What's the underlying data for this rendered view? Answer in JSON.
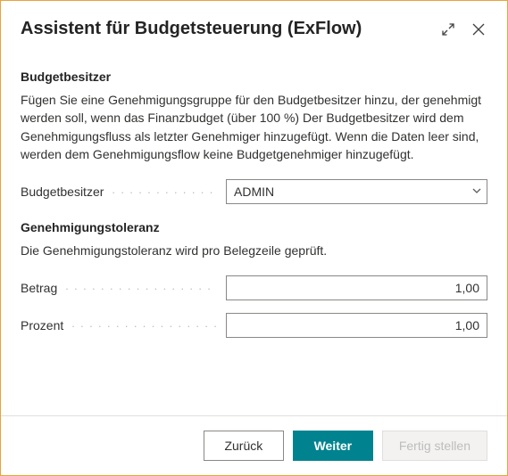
{
  "header": {
    "title": "Assistent für Budgetsteuerung (ExFlow)"
  },
  "section_owner": {
    "title": "Budgetbesitzer",
    "desc": "Fügen Sie eine Genehmigungsgruppe für den Budgetbesitzer hinzu, der genehmigt werden soll, wenn das Finanzbudget (über 100 %) Der Budgetbesitzer wird dem Genehmigungsfluss als letzter Genehmiger hinzugefügt. Wenn die Daten leer sind, werden dem Genehmigungsflow keine Budgetgenehmiger hinzugefügt.",
    "field_label": "Budgetbesitzer",
    "field_value": "ADMIN"
  },
  "section_tolerance": {
    "title": "Genehmigungstoleranz",
    "desc": "Die Genehmigungstoleranz wird pro Belegzeile geprüft.",
    "amount_label": "Betrag",
    "amount_value": "1,00",
    "percent_label": "Prozent",
    "percent_value": "1,00"
  },
  "footer": {
    "back": "Zurück",
    "next": "Weiter",
    "finish": "Fertig stellen"
  }
}
